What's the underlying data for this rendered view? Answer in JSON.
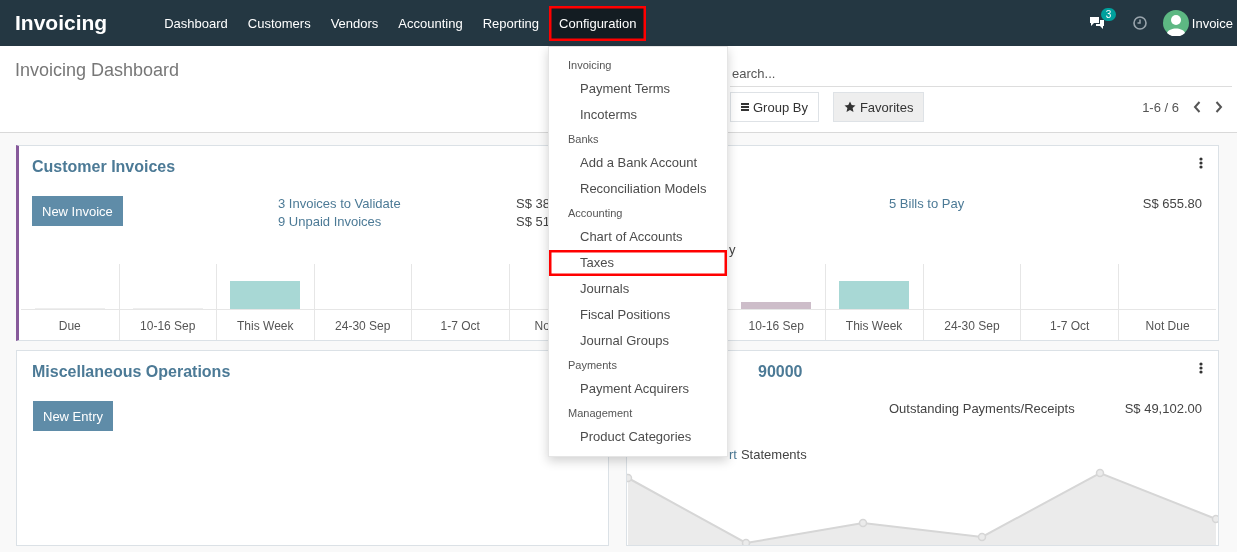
{
  "navbar": {
    "app_name": "Invoicing",
    "menu": [
      {
        "label": "Dashboard",
        "selected": false,
        "highlighted": false
      },
      {
        "label": "Customers",
        "selected": false,
        "highlighted": false
      },
      {
        "label": "Vendors",
        "selected": false,
        "highlighted": false
      },
      {
        "label": "Accounting",
        "selected": false,
        "highlighted": false
      },
      {
        "label": "Reporting",
        "selected": false,
        "highlighted": false
      },
      {
        "label": "Configuration",
        "selected": true,
        "highlighted": true
      }
    ],
    "messages_badge": "3",
    "user_name": "Invoice"
  },
  "control_panel": {
    "title": "Invoicing Dashboard",
    "search": {
      "placeholder": "earch..."
    },
    "buttons": [
      {
        "label": "Group By",
        "kind": "group"
      },
      {
        "label": "Favorites",
        "kind": "favorites"
      }
    ],
    "pager": "1-6 / 6"
  },
  "cards": [
    {
      "kind": "sale",
      "title": "Customer Invoices",
      "button": "New Invoice",
      "rows": [
        {
          "kind": "link",
          "text": "3 Invoices to Validate",
          "amount": "S$ 38"
        },
        {
          "kind": "link",
          "text": "9 Unpaid Invoices",
          "amount": "S$ 51"
        }
      ],
      "chart_labels": [
        "Due",
        "10-16 Sep",
        "This Week",
        "24-30 Sep",
        "1-7 Oct",
        "No"
      ]
    },
    {
      "kind": "purchase",
      "menu_icon": true,
      "rows": [
        {
          "kind": "link",
          "text": "5 Bills to Pay",
          "amount": "S$ 655.80"
        }
      ],
      "notes": [
        {
          "kind": "text",
          "text": "y"
        }
      ],
      "chart_labels": [
        "10-16 Sep",
        "This Week",
        "24-30 Sep",
        "1-7 Oct",
        "Not Due"
      ]
    },
    {
      "kind": "general",
      "title": "Miscellaneous Operations",
      "button": "New Entry"
    },
    {
      "kind": "bank",
      "title": "90000",
      "menu_icon": true,
      "rows": [
        {
          "kind": "text",
          "text": "Outstanding Payments/Receipts",
          "amount": "S$ 49,102.00"
        }
      ],
      "notes": [
        {
          "kind": "link",
          "text": "rt"
        },
        {
          "kind": "text",
          "text": "Statements"
        }
      ]
    }
  ],
  "dropdown": {
    "sections": [
      {
        "header": "Invoicing",
        "items": [
          {
            "label": "Payment Terms",
            "highlighted": false
          },
          {
            "label": "Incoterms",
            "highlighted": false
          }
        ]
      },
      {
        "header": "Banks",
        "items": [
          {
            "label": "Add a Bank Account",
            "highlighted": false
          },
          {
            "label": "Reconciliation Models",
            "highlighted": false
          }
        ]
      },
      {
        "header": "Accounting",
        "items": [
          {
            "label": "Chart of Accounts",
            "highlighted": false
          },
          {
            "label": "Taxes",
            "highlighted": true
          },
          {
            "label": "Journals",
            "highlighted": false
          },
          {
            "label": "Fiscal Positions",
            "highlighted": false
          },
          {
            "label": "Journal Groups",
            "highlighted": false
          }
        ]
      },
      {
        "header": "Payments",
        "items": [
          {
            "label": "Payment Acquirers",
            "highlighted": false
          }
        ]
      },
      {
        "header": "Management",
        "items": [
          {
            "label": "Product Categories",
            "highlighted": false
          }
        ]
      }
    ]
  }
}
